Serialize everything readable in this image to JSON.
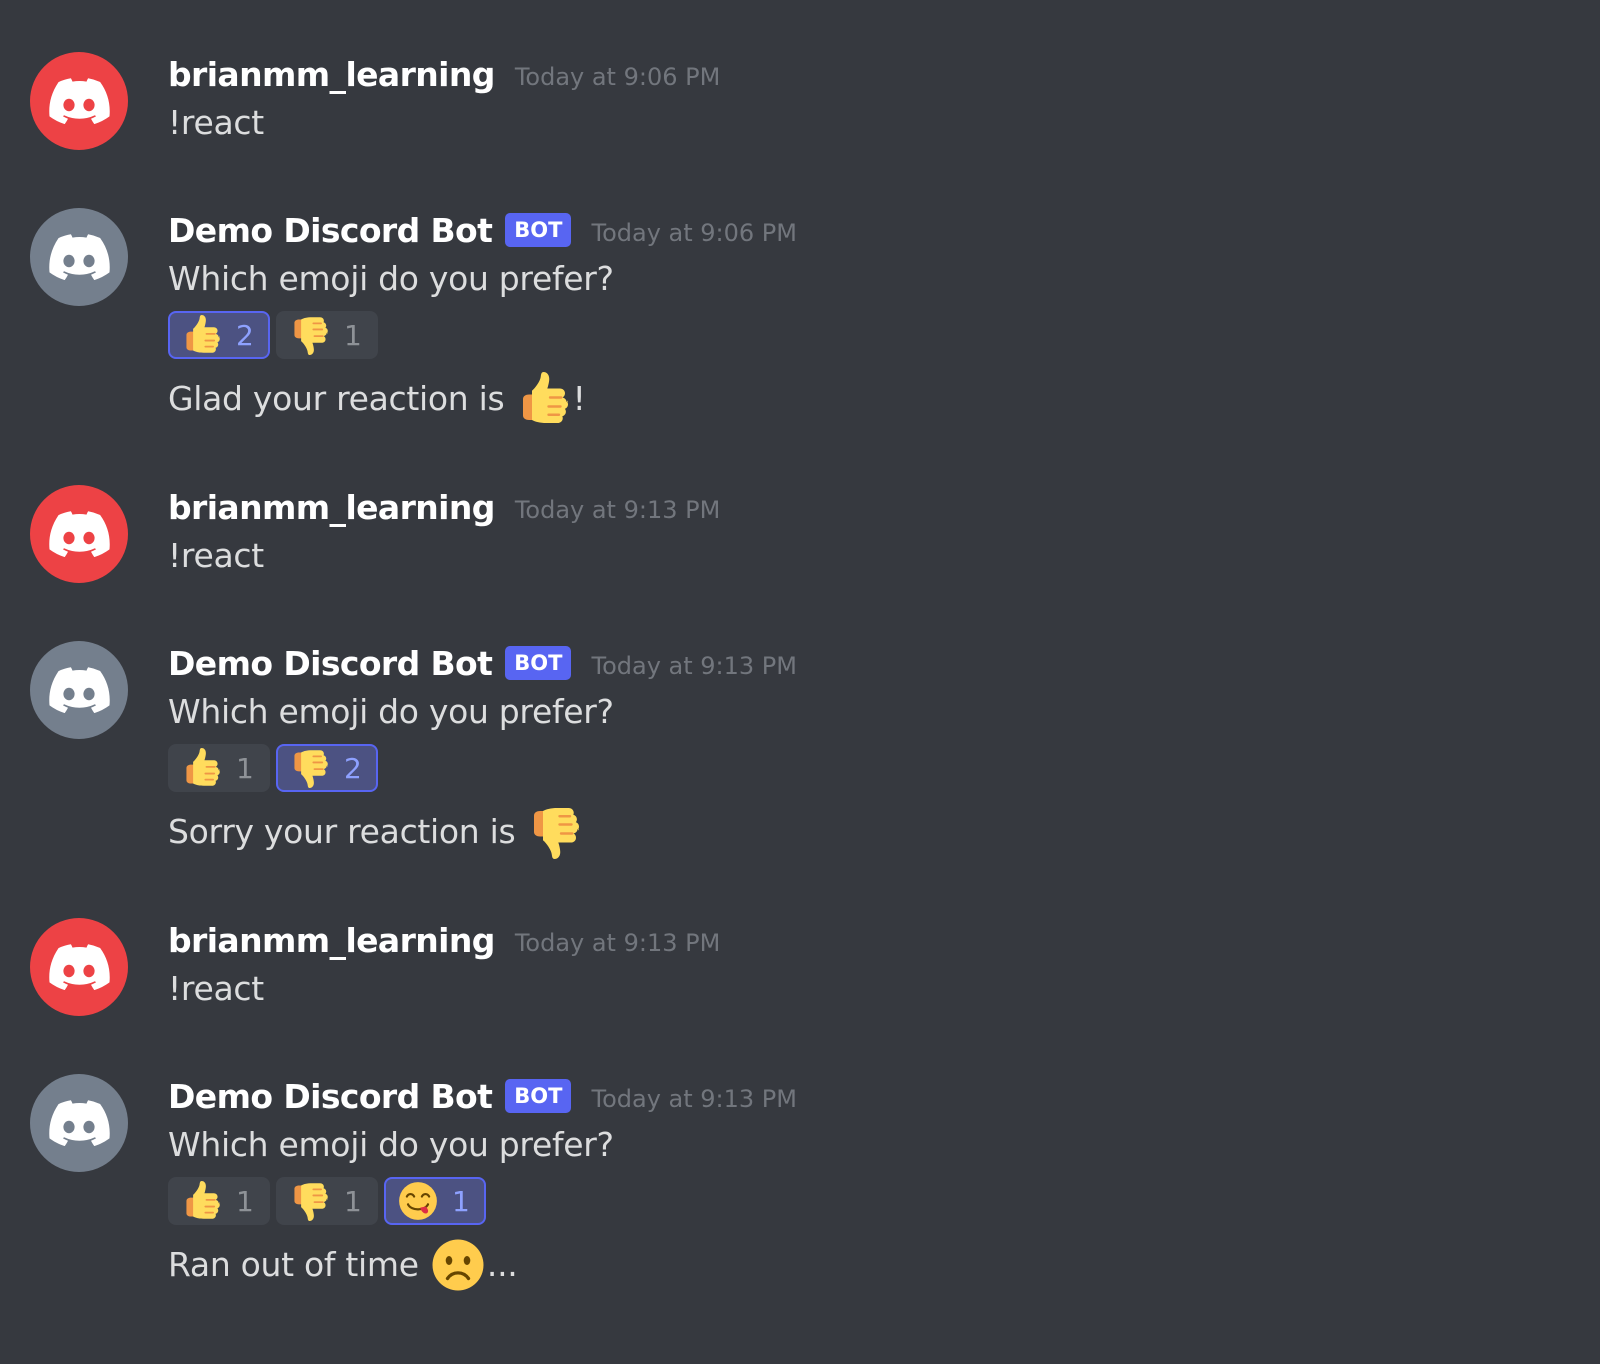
{
  "colors": {
    "background": "#36393f",
    "user_avatar": "#ed4245",
    "bot_avatar": "#747f8d",
    "bot_tag": "#5865f2",
    "text": "#dcddde",
    "timestamp": "#72767d"
  },
  "messages": [
    {
      "author": "brianmm_learning",
      "is_bot": false,
      "timestamp": "Today at 9:06 PM",
      "content": "!react"
    },
    {
      "author": "Demo Discord Bot",
      "is_bot": true,
      "bot_tag": "BOT",
      "timestamp": "Today at 9:06 PM",
      "content": "Which emoji do you prefer?",
      "reactions": [
        {
          "emoji": "thumbs-up",
          "count": "2",
          "me": true
        },
        {
          "emoji": "thumbs-down",
          "count": "1",
          "me": false
        }
      ],
      "followup": {
        "before": "Glad your reaction is ",
        "emoji": "thumbs-up",
        "after": "!"
      }
    },
    {
      "author": "brianmm_learning",
      "is_bot": false,
      "timestamp": "Today at 9:13 PM",
      "content": "!react"
    },
    {
      "author": "Demo Discord Bot",
      "is_bot": true,
      "bot_tag": "BOT",
      "timestamp": "Today at 9:13 PM",
      "content": "Which emoji do you prefer?",
      "reactions": [
        {
          "emoji": "thumbs-up",
          "count": "1",
          "me": false
        },
        {
          "emoji": "thumbs-down",
          "count": "2",
          "me": true
        }
      ],
      "followup": {
        "before": "Sorry your reaction is ",
        "emoji": "thumbs-down",
        "after": ""
      }
    },
    {
      "author": "brianmm_learning",
      "is_bot": false,
      "timestamp": "Today at 9:13 PM",
      "content": "!react"
    },
    {
      "author": "Demo Discord Bot",
      "is_bot": true,
      "bot_tag": "BOT",
      "timestamp": "Today at 9:13 PM",
      "content": "Which emoji do you prefer?",
      "reactions": [
        {
          "emoji": "thumbs-up",
          "count": "1",
          "me": false
        },
        {
          "emoji": "thumbs-down",
          "count": "1",
          "me": false
        },
        {
          "emoji": "yum-face",
          "count": "1",
          "me": true
        }
      ],
      "followup": {
        "before": "Ran out of time ",
        "emoji": "frowning-face",
        "after": "..."
      }
    }
  ]
}
